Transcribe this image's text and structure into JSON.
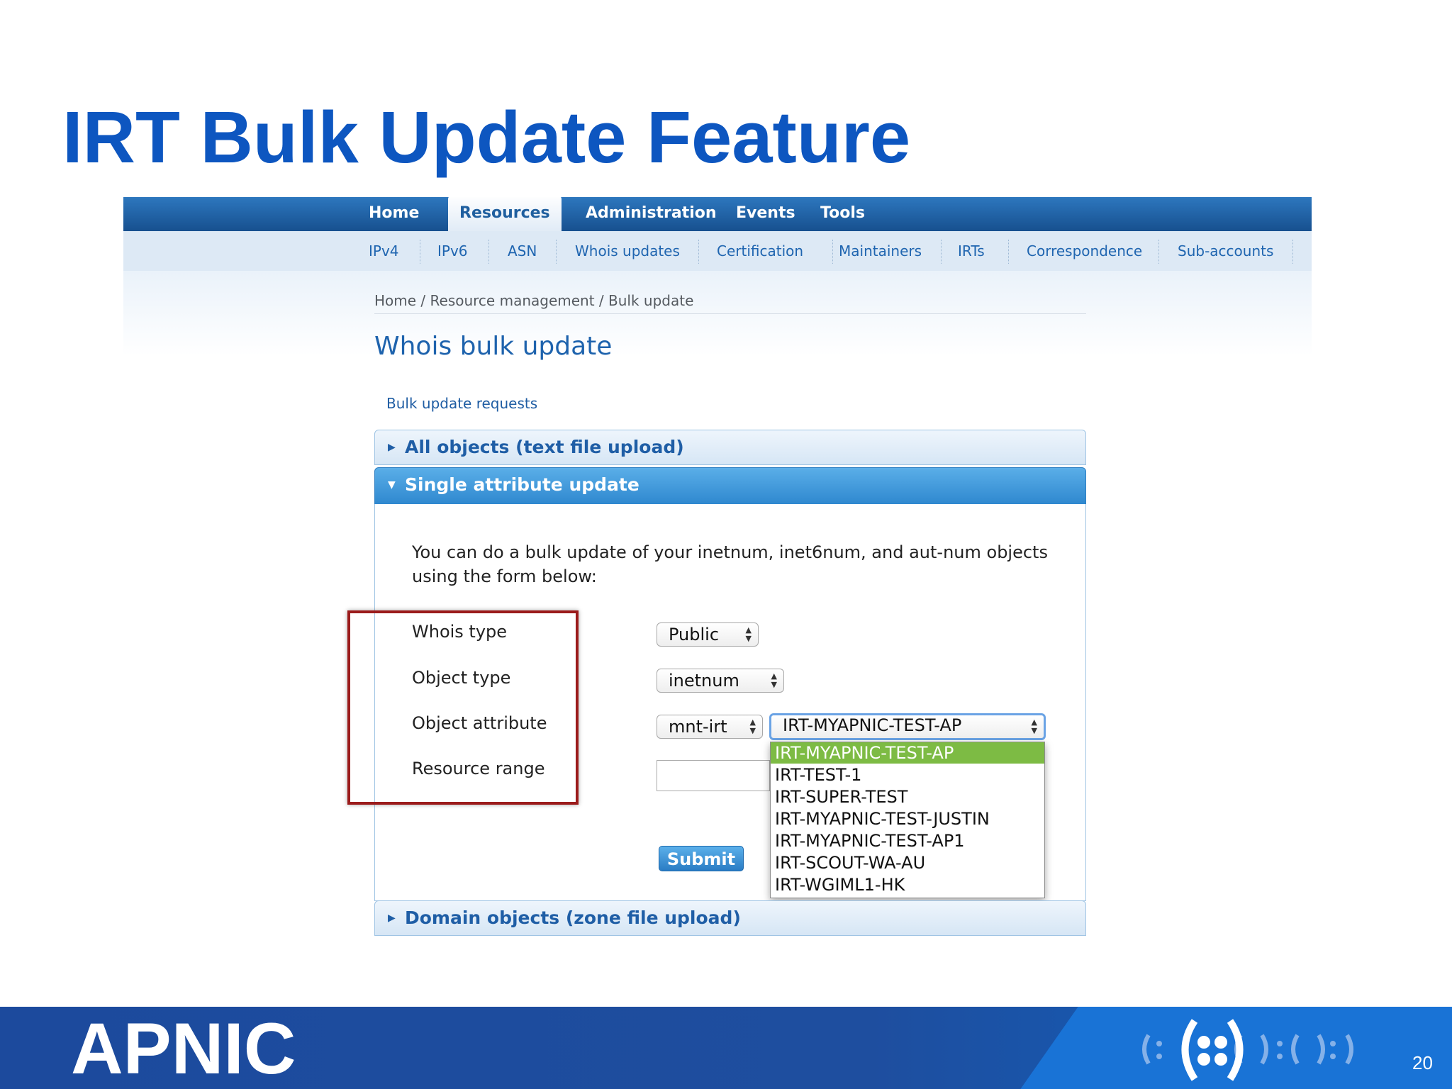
{
  "slide": {
    "title": "IRT Bulk Update Feature",
    "page_number": "20",
    "footer_logo": "APNIC"
  },
  "top_nav": {
    "items": [
      "Home",
      "Resources",
      "Administration",
      "Events",
      "Tools"
    ],
    "active": "Resources"
  },
  "sub_nav": {
    "items": [
      "IPv4",
      "IPv6",
      "ASN",
      "Whois updates",
      "Certification",
      "Maintainers",
      "IRTs",
      "Correspondence",
      "Sub-accounts"
    ]
  },
  "breadcrumb": "Home / Resource management / Bulk update",
  "page_heading": "Whois bulk update",
  "sub_link": "Bulk update requests",
  "accordion": {
    "all_objects": "All objects (text file upload)",
    "single_attribute": "Single attribute update",
    "domain_objects": "Domain objects (zone file upload)"
  },
  "intro_text": "You can do a bulk update of your inetnum, inet6num, and aut-num objects using the form below:",
  "form": {
    "whois_type_label": "Whois type",
    "whois_type_value": "Public",
    "object_type_label": "Object type",
    "object_type_value": "inetnum",
    "object_attribute_label": "Object attribute",
    "object_attribute_value": "mnt-irt",
    "irt_value": "IRT-MYAPNIC-TEST-AP",
    "resource_range_label": "Resource range",
    "resource_range_value": "",
    "submit_label": "Submit"
  },
  "dropdown_options": [
    "IRT-MYAPNIC-TEST-AP",
    "IRT-TEST-1",
    "IRT-SUPER-TEST",
    "IRT-MYAPNIC-TEST-JUSTIN",
    "IRT-MYAPNIC-TEST-AP1",
    "IRT-SCOUT-WA-AU",
    "IRT-WGIML1-HK"
  ],
  "colors": {
    "title_blue": "#0d56c0",
    "highlight_red": "#9b1b1b",
    "selected_green": "#7dbb44"
  }
}
